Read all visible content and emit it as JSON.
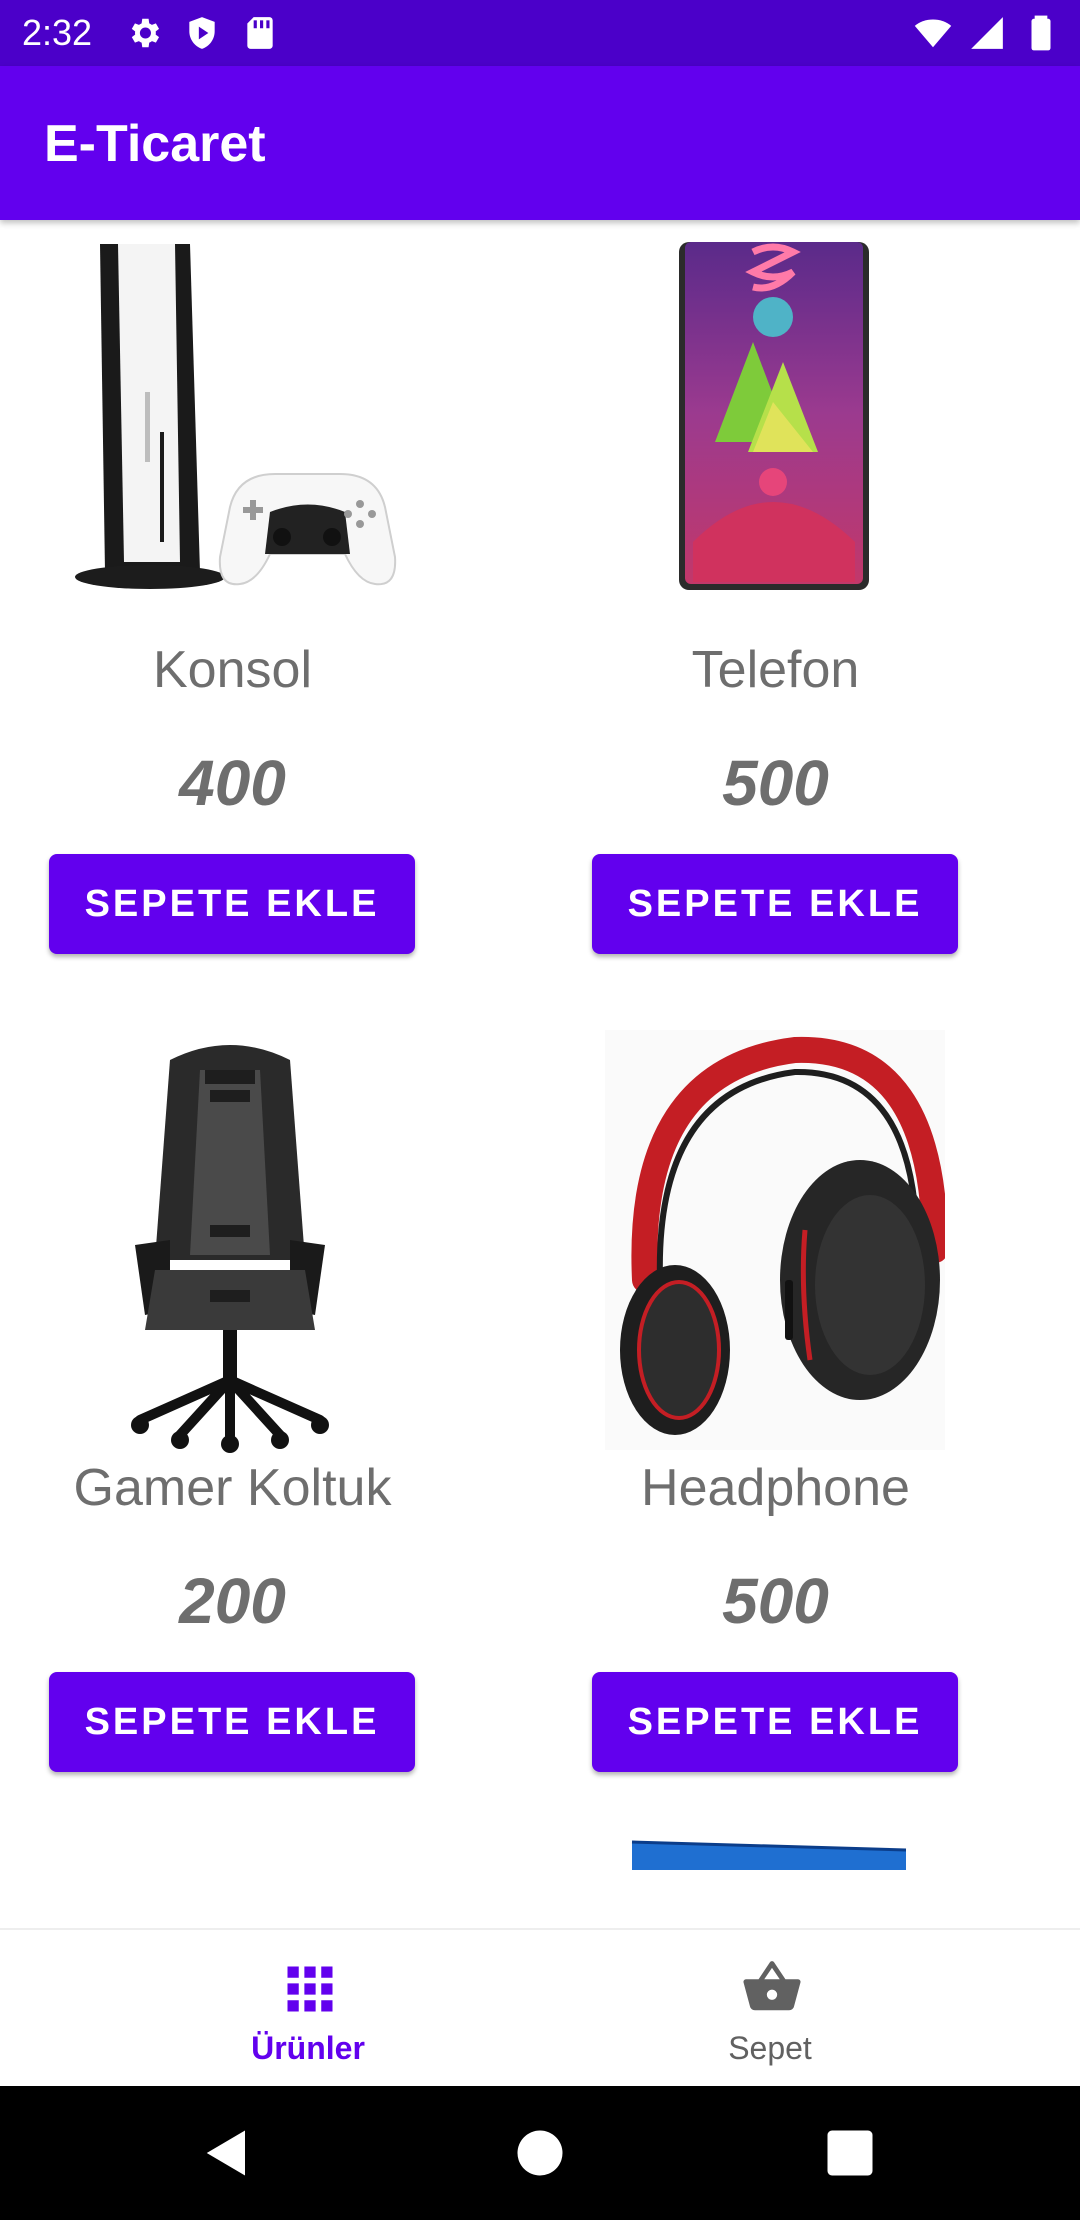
{
  "status_bar": {
    "time": "2:32",
    "left_icons": [
      "gear-icon",
      "shield-icon",
      "sd-card-icon"
    ],
    "right_icons": [
      "wifi-icon",
      "signal-icon",
      "battery-icon"
    ],
    "color": "#4b00c9"
  },
  "app_bar": {
    "title": "E-Ticaret",
    "color": "#6200ee"
  },
  "products": [
    {
      "name": "Konsol",
      "price": "400",
      "button_label": "SEPETE EKLE",
      "image_icon": "game-console-icon"
    },
    {
      "name": "Telefon",
      "price": "500",
      "button_label": "SEPETE EKLE",
      "image_icon": "smartphone-icon"
    },
    {
      "name": "Gamer Koltuk",
      "price": "200",
      "button_label": "SEPETE EKLE",
      "image_icon": "gaming-chair-icon"
    },
    {
      "name": "Headphone",
      "price": "500",
      "button_label": "SEPETE EKLE",
      "image_icon": "headphone-icon"
    }
  ],
  "bottom_nav": {
    "items": [
      {
        "label": "Ürünler",
        "icon": "grid-icon",
        "active": true
      },
      {
        "label": "Sepet",
        "icon": "basket-icon",
        "active": false
      }
    ],
    "active_color": "#6200ee",
    "inactive_color": "#616161"
  },
  "system_nav": {
    "buttons": [
      "back-icon",
      "home-icon",
      "recents-icon"
    ]
  }
}
